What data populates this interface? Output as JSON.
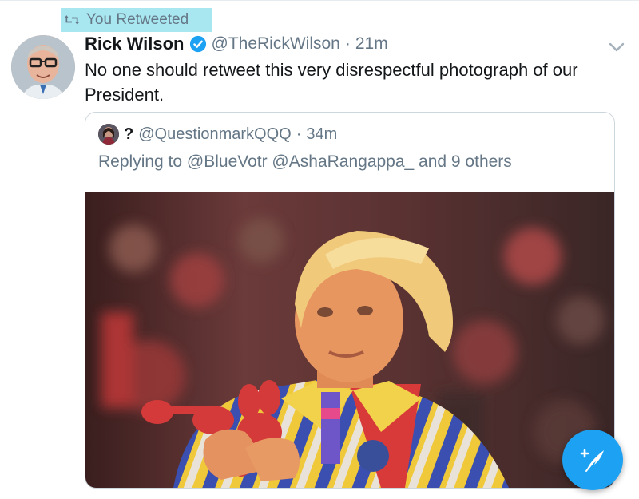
{
  "retweet_context": {
    "label": "You Retweeted",
    "icon": "retweet-icon"
  },
  "tweet": {
    "display_name": "Rick Wilson",
    "handle": "@TheRickWilson",
    "separator": "·",
    "time": "21m",
    "text": "No one should retweet this very disrespectful photograph of our President.",
    "verified": true
  },
  "quoted": {
    "display_name": "?",
    "handle": "@QuestionmarkQQQ",
    "separator": "·",
    "time": "34m",
    "reply_line": "Replying to @BlueVotr @AshaRangappa_ and 9 others"
  },
  "colors": {
    "accent": "#1da1f2",
    "muted_text": "#657786",
    "highlight": "#a8e6f0"
  }
}
